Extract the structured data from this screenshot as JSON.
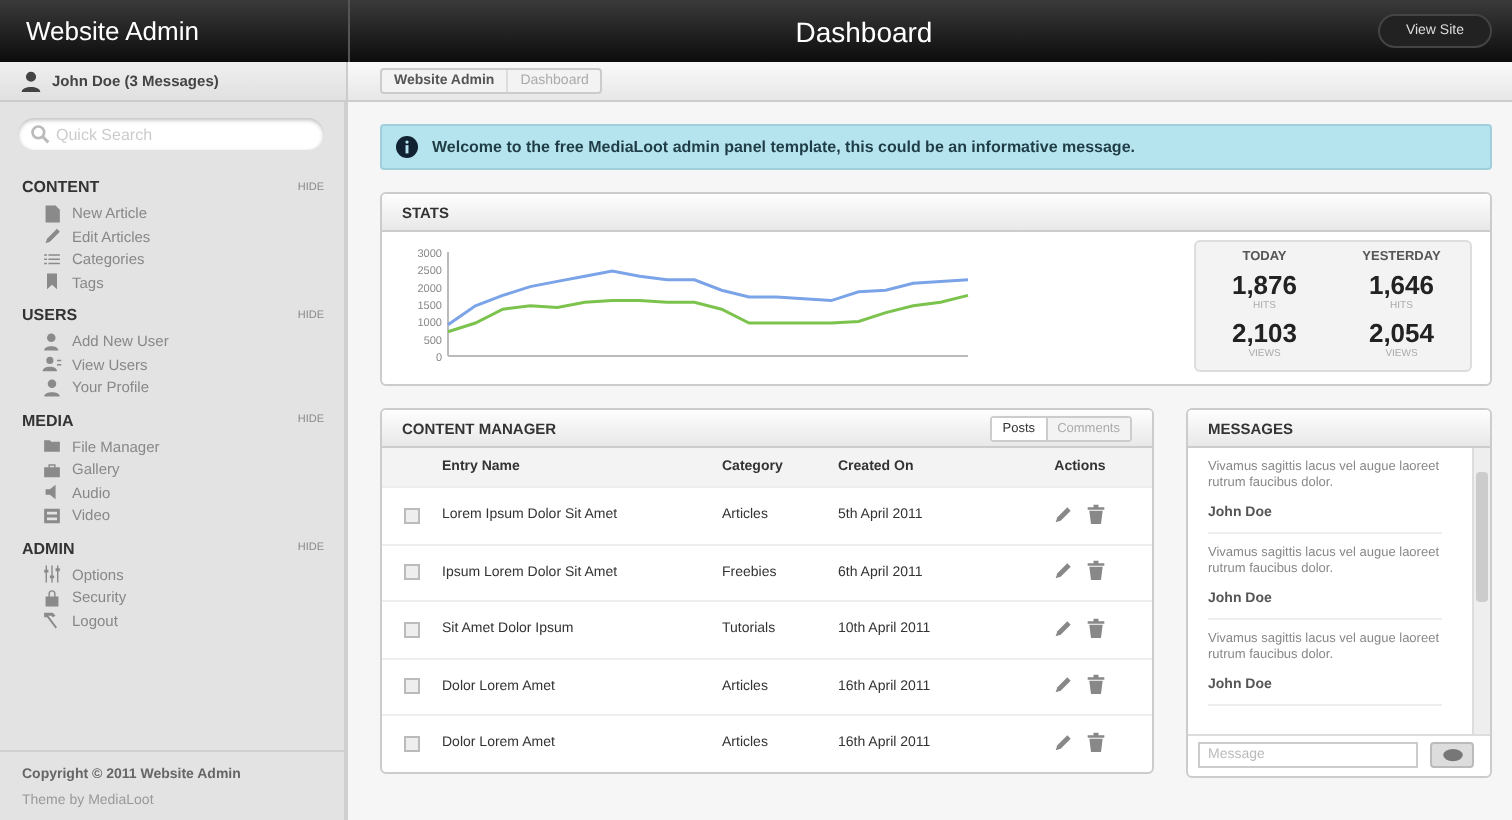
{
  "header": {
    "site_title": "Website Admin",
    "page_title": "Dashboard",
    "view_site_button": "View Site"
  },
  "user_bar": {
    "user": "John Doe (3 Messages)"
  },
  "breadcrumbs": [
    {
      "label": "Website Admin",
      "selected": true
    },
    {
      "label": "Dashboard",
      "selected": false
    }
  ],
  "sidebar": {
    "search": {
      "placeholder": "Quick Search"
    },
    "sections": [
      {
        "title": "CONTENT",
        "hide": "HIDE",
        "items": [
          "New Article",
          "Edit Articles",
          "Categories",
          "Tags"
        ]
      },
      {
        "title": "USERS",
        "hide": "HIDE",
        "items": [
          "Add New User",
          "View Users",
          "Your Profile"
        ]
      },
      {
        "title": "MEDIA",
        "hide": "HIDE",
        "items": [
          "File Manager",
          "Gallery",
          "Audio",
          "Video"
        ]
      },
      {
        "title": "ADMIN",
        "hide": "HIDE",
        "items": [
          "Options",
          "Security",
          "Logout"
        ]
      }
    ],
    "copyright": "Copyright © 2011 Website Admin",
    "theme": "Theme by MediaLoot"
  },
  "info_message": "Welcome to the free MediaLoot admin panel template, this could be an informative message.",
  "stats": {
    "title": "STATS",
    "chart_data": {
      "type": "line",
      "ylim": [
        0,
        3000
      ],
      "yticks": [
        0,
        500,
        1000,
        1500,
        2000,
        2500,
        3000
      ],
      "series": [
        {
          "color": "#7ba3e8",
          "values": [
            900,
            1450,
            1750,
            2000,
            2150,
            2300,
            2450,
            2300,
            2200,
            2200,
            1900,
            1700,
            1700,
            1650,
            1600,
            1850,
            1900,
            2100,
            2150,
            2200
          ]
        },
        {
          "color": "#7cc34e",
          "values": [
            700,
            950,
            1350,
            1450,
            1400,
            1550,
            1600,
            1600,
            1550,
            1550,
            1350,
            950,
            950,
            950,
            950,
            1000,
            1250,
            1450,
            1550,
            1750
          ]
        }
      ]
    },
    "summary": [
      {
        "heading": "TODAY",
        "hits": "1,876",
        "hits_label": "HITS",
        "views": "2,103",
        "views_label": "VIEWS"
      },
      {
        "heading": "YESTERDAY",
        "hits": "1,646",
        "hits_label": "HITS",
        "views": "2,054",
        "views_label": "VIEWS"
      }
    ]
  },
  "content_manager": {
    "title": "CONTENT MANAGER",
    "tabs": [
      {
        "label": "Posts",
        "selected": true
      },
      {
        "label": "Comments",
        "selected": false
      }
    ],
    "columns": [
      "Entry Name",
      "Category",
      "Created On",
      "Actions"
    ],
    "rows": [
      {
        "checked": false,
        "name": "Lorem Ipsum Dolor Sit Amet",
        "category": "Articles",
        "created": "5th April 2011"
      },
      {
        "checked": false,
        "name": "Ipsum Lorem Dolor Sit Amet",
        "category": "Freebies",
        "created": "6th April 2011"
      },
      {
        "checked": false,
        "name": "Sit Amet Dolor Ipsum",
        "category": "Tutorials",
        "created": "10th April 2011"
      },
      {
        "checked": false,
        "name": "Dolor Lorem Amet",
        "category": "Articles",
        "created": "16th April 2011"
      },
      {
        "checked": false,
        "name": "Dolor Lorem Amet",
        "category": "Articles",
        "created": "16th April 2011"
      }
    ]
  },
  "messages": {
    "title": "MESSAGES",
    "items": [
      {
        "text": "Vivamus sagittis lacus vel augue laoreet rutrum faucibus dolor.",
        "author": "John Doe"
      },
      {
        "text": "Vivamus sagittis lacus vel augue laoreet rutrum faucibus dolor.",
        "author": "John Doe"
      },
      {
        "text": "Vivamus sagittis lacus vel augue laoreet rutrum faucibus dolor.",
        "author": "John Doe"
      }
    ],
    "input": {
      "placeholder": "Message"
    }
  }
}
